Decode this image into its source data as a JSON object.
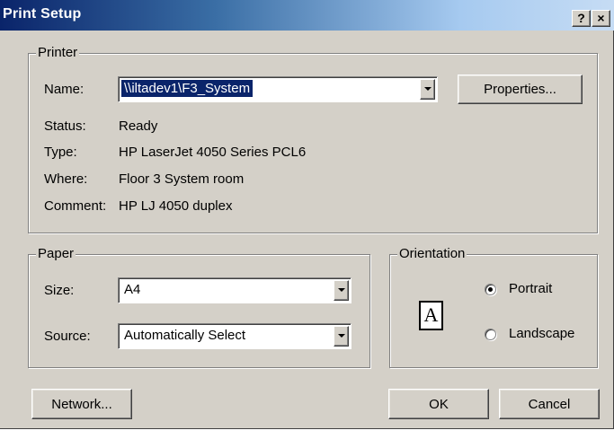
{
  "window": {
    "title": "Print Setup",
    "help_label": "?",
    "close_label": "×"
  },
  "printer": {
    "group_label": "Printer",
    "name_label": "Name:",
    "name_value": "\\\\iltadev1\\F3_System",
    "properties_label": "Properties...",
    "status_label": "Status:",
    "status_value": "Ready",
    "type_label": "Type:",
    "type_value": "HP LaserJet 4050 Series PCL6",
    "where_label": "Where:",
    "where_value": "Floor 3 System room",
    "comment_label": "Comment:",
    "comment_value": "HP LJ 4050 duplex"
  },
  "paper": {
    "group_label": "Paper",
    "size_label": "Size:",
    "size_value": "A4",
    "source_label": "Source:",
    "source_value": "Automatically Select"
  },
  "orientation": {
    "group_label": "Orientation",
    "icon_letter": "A",
    "portrait_label": "Portrait",
    "landscape_label": "Landscape",
    "selected": "Portrait"
  },
  "buttons": {
    "network_label": "Network...",
    "ok_label": "OK",
    "cancel_label": "Cancel"
  },
  "colors": {
    "titlebar_start": "#0a246a",
    "titlebar_end": "#c6dcf4",
    "dialog_face": "#d4d0c8",
    "selection": "#0a246a"
  }
}
